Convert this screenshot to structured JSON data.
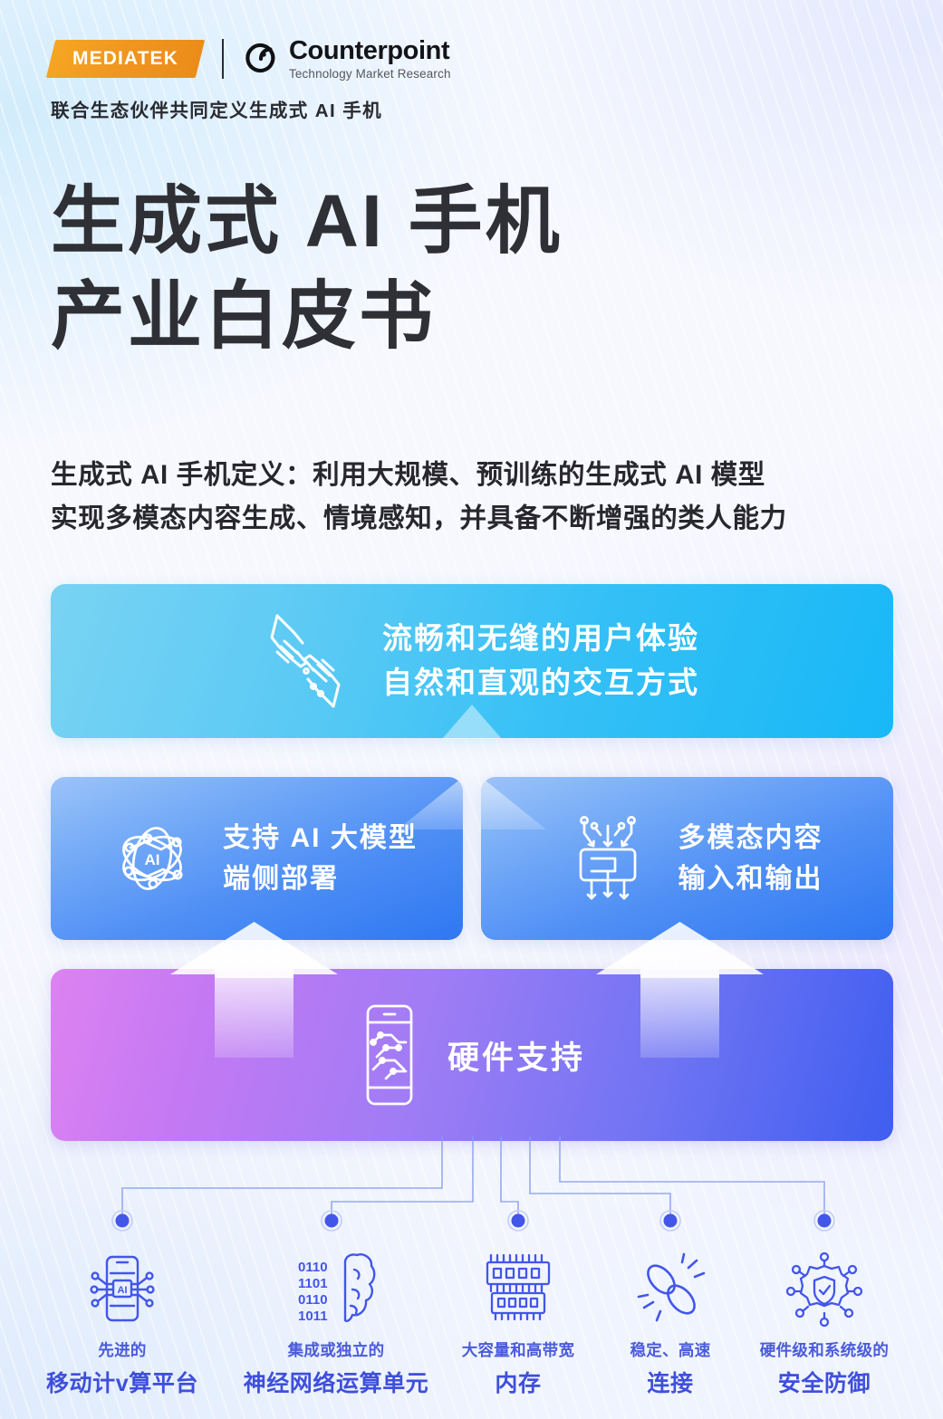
{
  "header": {
    "mediatek_logo_text": "MEDIATEK",
    "counterpoint_title": "Counterpoint",
    "counterpoint_subtitle": "Technology Market Research",
    "tagline": "联合生态伙伴共同定义生成式 AI 手机"
  },
  "title": {
    "line1": "生成式 AI 手机",
    "line2": "产业白皮书"
  },
  "definition": {
    "line1": "生成式 AI 手机定义：利用大规模、预训练的生成式 AI 模型",
    "line2": "实现多模态内容生成、情境感知，并具备不断增强的类人能力"
  },
  "cards": {
    "ux": {
      "icon": "hand-touch-icon",
      "line1": "流畅和无缝的用户体验",
      "line2": "自然和直观的交互方式",
      "color_start": "#79d3f3",
      "color_end": "#18b8f7"
    },
    "llm": {
      "icon": "ai-atom-network-icon",
      "line1": "支持 AI 大模型",
      "line2": "端侧部署",
      "color_start": "#9dc3f8",
      "color_end": "#2f77f2"
    },
    "multimodal": {
      "icon": "circuit-io-icon",
      "line1": "多模态内容",
      "line2": "输入和输出",
      "color_start": "#9dc3f8",
      "color_end": "#2f77f2"
    },
    "hardware": {
      "icon": "phone-circuit-icon",
      "label": "硬件支持",
      "color_start": "#dd82f2",
      "color_end": "#3f5ef0"
    }
  },
  "foundation_items": [
    {
      "icon": "phone-ai-chip-icon",
      "caption": "先进的",
      "label": "移动计v算平台"
    },
    {
      "icon": "binary-brain-icon",
      "caption": "集成或独立的",
      "label": "神经网络运算单元"
    },
    {
      "icon": "memory-chip-icon",
      "caption": "大容量和高带宽",
      "label": "内存"
    },
    {
      "icon": "chain-link-icon",
      "caption": "稳定、高速",
      "label": "连接"
    },
    {
      "icon": "shield-gear-icon",
      "caption": "硬件级和系统级的",
      "label": "安全防御"
    }
  ],
  "theme": {
    "accent_blue": "#3f4fdb",
    "mediatek_orange": "#f0941f",
    "title_ink": "#2f3035"
  }
}
